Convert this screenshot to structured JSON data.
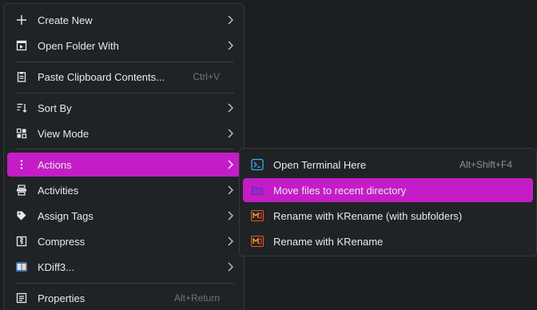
{
  "main_menu": {
    "items": [
      {
        "label": "Create New",
        "icon": "plus-icon",
        "submenu": true
      },
      {
        "label": "Open Folder With",
        "icon": "open-with-icon",
        "submenu": true
      },
      {
        "label": "Paste Clipboard Contents...",
        "icon": "clipboard-icon",
        "shortcut": "Ctrl+V"
      },
      {
        "label": "Sort By",
        "icon": "sort-icon",
        "submenu": true
      },
      {
        "label": "View Mode",
        "icon": "view-mode-icon",
        "submenu": true
      },
      {
        "label": "Actions",
        "icon": "vertical-dots-icon",
        "submenu": true,
        "active": true
      },
      {
        "label": "Activities",
        "icon": "activities-icon",
        "submenu": true
      },
      {
        "label": "Assign Tags",
        "icon": "tag-icon",
        "submenu": true
      },
      {
        "label": "Compress",
        "icon": "compress-icon",
        "submenu": true
      },
      {
        "label": "KDiff3...",
        "icon": "kdiff3-icon",
        "submenu": true
      },
      {
        "label": "Properties",
        "icon": "properties-icon",
        "shortcut": "Alt+Return"
      }
    ]
  },
  "actions_submenu": {
    "items": [
      {
        "label": "Open Terminal Here",
        "icon": "terminal-icon",
        "shortcut": "Alt+Shift+F4"
      },
      {
        "label": "Move files to recent directory",
        "icon": "folder-move-icon",
        "active": true
      },
      {
        "label": "Rename with KRename (with subfolders)",
        "icon": "krename-icon"
      },
      {
        "label": "Rename with KRename",
        "icon": "krename-icon"
      }
    ]
  },
  "colors": {
    "menu_background": "#202326",
    "highlight": "#c41dc7",
    "text": "#e8e9ea",
    "shortcut_text": "#6f7479"
  }
}
